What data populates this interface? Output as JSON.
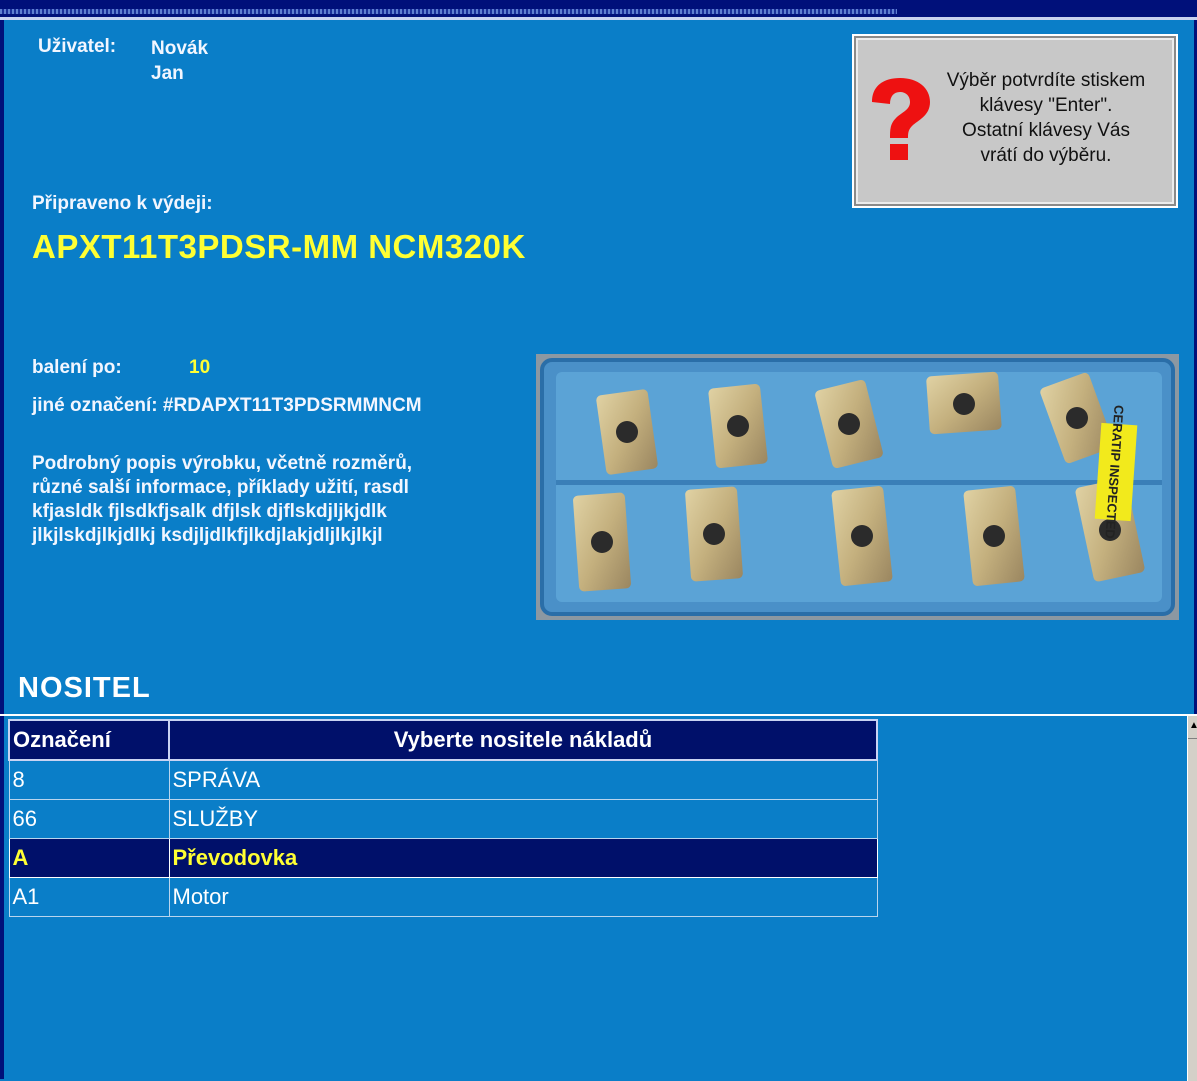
{
  "user": {
    "label": "Uživatel:",
    "first_line": "Novák",
    "second_line": "Jan"
  },
  "help": {
    "line1": "Výběr potvrdíte stiskem",
    "line2": "klávesy \"Enter\".",
    "line3": "Ostatní klávesy Vás",
    "line4": "vrátí do výběru."
  },
  "product": {
    "ready_label": "Připraveno k výdeji:",
    "code": "APXT11T3PDSR-MM NCM320K",
    "pack_label": "balení po:",
    "pack_value": "10",
    "alt_label_and_code": "jiné označení: #RDAPXT11T3PDSRMMNCM",
    "description_lines": [
      "Podrobný popis výrobku, včetně rozměrů,",
      "různé salší informace, příklady užití, rasdl",
      "kfjasldk fjlsdkfjsalk dfjlsk djflskdjljkjdlk",
      "jlkjlskdjlkjdlkj ksdjljdlkfjlkdjlakjdljlkjlkjl"
    ],
    "photo_label": "CERATIP INSPECTED"
  },
  "section": {
    "title": "NOSITEL"
  },
  "table": {
    "headers": [
      "Označení",
      "Vyberte nositele nákladů"
    ],
    "rows": [
      {
        "code": "8",
        "name": "SPRÁVA"
      },
      {
        "code": "66",
        "name": "SLUŽBY"
      },
      {
        "code": "A",
        "name": "Převodovka"
      },
      {
        "code": "A1",
        "name": "Motor"
      }
    ],
    "selected_index": 2
  },
  "colors": {
    "background": "#0a7ec8",
    "frame": "#00107a",
    "highlight": "#ffff33",
    "selected_row": "#00106a"
  }
}
